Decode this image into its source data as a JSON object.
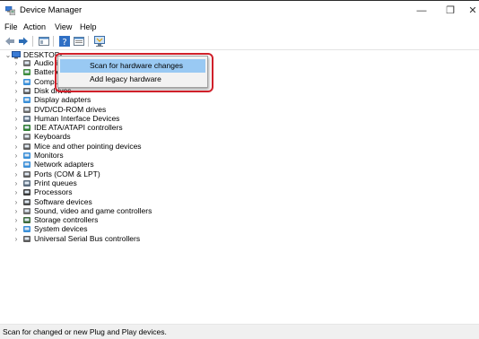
{
  "window": {
    "title": "Device Manager",
    "minimize_glyph": "—",
    "maximize_glyph": "❐",
    "close_glyph": "✕"
  },
  "menubar": [
    "File",
    "Action",
    "View",
    "Help"
  ],
  "toolbar": {
    "buttons": [
      "back-arrow-icon",
      "forward-arrow-icon",
      "show-hide-console-tree-icon",
      "help-icon",
      "properties-icon",
      "monitor-icon"
    ]
  },
  "tree": {
    "root": "DESKTOP-",
    "items": [
      {
        "label": "Audio inputs and outputs",
        "icon": "speaker-icon"
      },
      {
        "label": "Batteries",
        "icon": "battery-icon"
      },
      {
        "label": "Computer",
        "icon": "computer-icon"
      },
      {
        "label": "Disk drives",
        "icon": "disk-drive-icon"
      },
      {
        "label": "Display adapters",
        "icon": "display-adapter-icon"
      },
      {
        "label": "DVD/CD-ROM drives",
        "icon": "dvd-drive-icon"
      },
      {
        "label": "Human Interface Devices",
        "icon": "hid-icon"
      },
      {
        "label": "IDE ATA/ATAPI controllers",
        "icon": "ide-controller-icon"
      },
      {
        "label": "Keyboards",
        "icon": "keyboard-icon"
      },
      {
        "label": "Mice and other pointing devices",
        "icon": "mouse-icon"
      },
      {
        "label": "Monitors",
        "icon": "monitor-icon"
      },
      {
        "label": "Network adapters",
        "icon": "network-adapter-icon"
      },
      {
        "label": "Ports (COM & LPT)",
        "icon": "port-icon"
      },
      {
        "label": "Print queues",
        "icon": "printer-icon"
      },
      {
        "label": "Processors",
        "icon": "processor-icon"
      },
      {
        "label": "Software devices",
        "icon": "software-device-icon"
      },
      {
        "label": "Sound, video and game controllers",
        "icon": "sound-controller-icon"
      },
      {
        "label": "Storage controllers",
        "icon": "storage-controller-icon"
      },
      {
        "label": "System devices",
        "icon": "system-device-icon"
      },
      {
        "label": "Universal Serial Bus controllers",
        "icon": "usb-icon"
      }
    ]
  },
  "context_menu": {
    "items": [
      "Scan for hardware changes",
      "Add legacy hardware"
    ],
    "highlighted_index": 0
  },
  "statusbar": {
    "text": "Scan for changed or new Plug and Play devices."
  }
}
